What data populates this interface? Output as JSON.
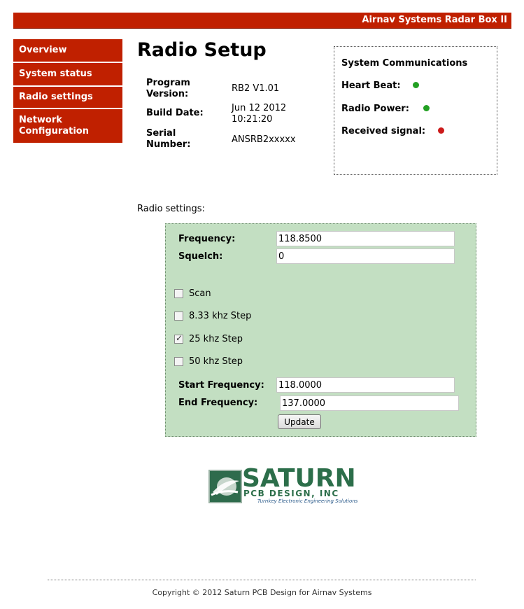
{
  "header": {
    "title": "Airnav Systems Radar Box II"
  },
  "nav": {
    "items": [
      {
        "label": "Overview"
      },
      {
        "label": "System status"
      },
      {
        "label": "Radio settings"
      },
      {
        "label": "Network Configuration"
      }
    ]
  },
  "page": {
    "title": "Radio Setup"
  },
  "info": {
    "program_version_label": "Program Version:",
    "program_version_value": "RB2 V1.01",
    "build_date_label": "Build Date:",
    "build_date_value": "Jun 12 2012 10:21:20",
    "serial_label": "Serial Number:",
    "serial_value": "ANSRB2xxxxx"
  },
  "system_comm": {
    "title": "System Communications",
    "heartbeat_label": "Heart Beat:",
    "heartbeat_color": "#22a022",
    "power_label": "Radio Power:",
    "power_color": "#22a022",
    "signal_label": "Received signal:",
    "signal_color": "#cc1a1a"
  },
  "settings": {
    "heading": "Radio settings:",
    "frequency_label": "Frequency:",
    "frequency_value": "118.8500",
    "squelch_label": "Squelch:",
    "squelch_value": "0",
    "scan_label": "Scan",
    "scan_checked": false,
    "step833_label": "8.33 khz Step",
    "step833_checked": false,
    "step25_label": "25 khz Step",
    "step25_checked": true,
    "step50_label": "50 khz Step",
    "step50_checked": false,
    "start_label": "Start Frequency:",
    "start_value": "118.0000",
    "end_label": "End Frequency:",
    "end_value": "137.0000",
    "update_label": "Update"
  },
  "logo": {
    "word": "SATURN",
    "sub": "PCB DESIGN, INC",
    "tagline": "Turnkey Electronic Engineering Solutions",
    "icon": "saturn-logo-icon"
  },
  "footer": {
    "copyright": "Copyright © 2012 Saturn PCB Design for Airnav Systems"
  },
  "colors": {
    "brand_red": "#c02000",
    "panel_green": "#c3dfc2",
    "logo_green": "#2c6e4a"
  }
}
